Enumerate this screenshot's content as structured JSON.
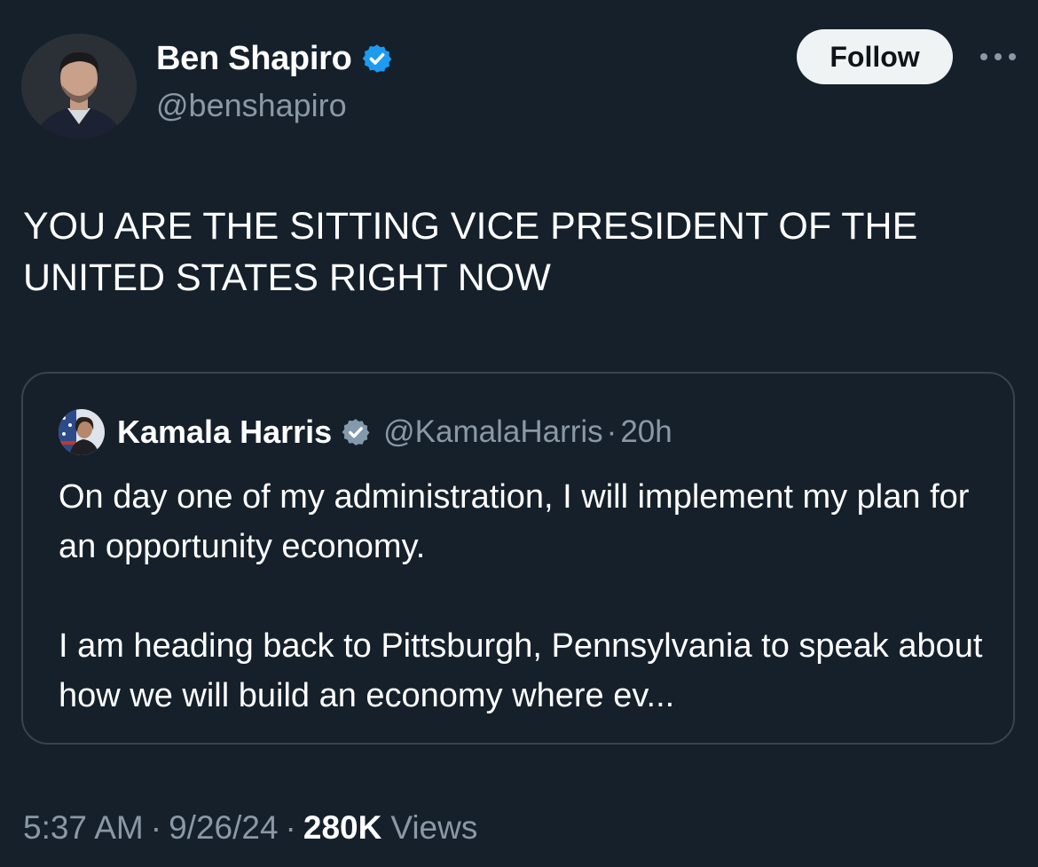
{
  "author": {
    "display_name": "Ben Shapiro",
    "handle": "@benshapiro",
    "verified_icon": "verified-badge-icon"
  },
  "follow_label": "Follow",
  "more_icon": "more-options-icon",
  "tweet": {
    "text": "YOU ARE THE SITTING VICE PRESIDENT OF THE\nUNITED STATES RIGHT NOW"
  },
  "quoted_tweet": {
    "display_name": "Kamala Harris",
    "handle": "@KamalaHarris",
    "separator": "·",
    "time": "20h",
    "paragraphs": [
      "On day one of my administration, I will implement my plan for an opportunity economy.",
      "I am heading back to Pittsburgh, Pennsylvania to speak about how we will build an economy where ev..."
    ]
  },
  "meta": {
    "time": "5:37 AM",
    "separator": "·",
    "date": "9/26/24",
    "views_count": "280K",
    "views_label": "Views"
  },
  "colors": {
    "background": "#15202b",
    "verified_blue": "#1d9bf0",
    "secondary_text": "#8b98a5",
    "border": "#38444d"
  }
}
